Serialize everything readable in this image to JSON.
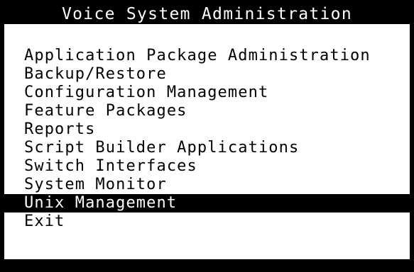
{
  "window": {
    "title": "Voice System Administration"
  },
  "menu": {
    "selected_index": 8,
    "items": [
      {
        "label": "Application Package Administration"
      },
      {
        "label": "Backup/Restore"
      },
      {
        "label": "Configuration Management"
      },
      {
        "label": "Feature Packages"
      },
      {
        "label": "Reports"
      },
      {
        "label": "Script Builder Applications"
      },
      {
        "label": "Switch Interfaces"
      },
      {
        "label": "System Monitor"
      },
      {
        "label": "Unix Management"
      },
      {
        "label": "Exit"
      }
    ]
  },
  "colors": {
    "frame": "#000000",
    "background": "#ffffff",
    "highlight": "#000000",
    "highlight_text": "#ffffff"
  }
}
